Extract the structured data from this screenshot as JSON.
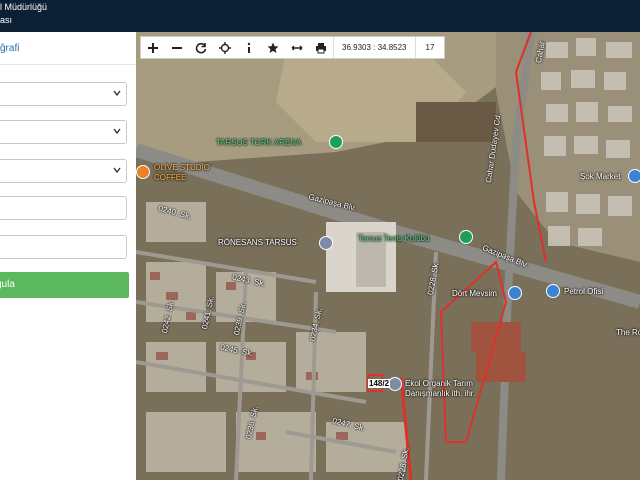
{
  "header": {
    "title_line1": "l Müdürlüğü",
    "title_line2": "ası"
  },
  "panel": {
    "header_label": "ğrafi",
    "submit_label": "gula",
    "fields": [
      {
        "type": "select",
        "value": ""
      },
      {
        "type": "select",
        "value": ""
      },
      {
        "type": "select",
        "value": ""
      },
      {
        "type": "input",
        "value": ""
      },
      {
        "type": "input",
        "value": ""
      }
    ]
  },
  "toolbar": {
    "icons": [
      "plus-icon",
      "minus-icon",
      "refresh-icon",
      "crosshair-icon",
      "info-icon",
      "star-icon",
      "measure-icon",
      "print-icon"
    ],
    "coordinates": "36.9303 : 34.8523",
    "zoom_level": "17"
  },
  "map": {
    "places": {
      "tarsus_tork_arena": "TARSUS TORK ARENA",
      "olive_studio_1": "OLİVE STUDİO",
      "olive_studio_2": "COFFEE",
      "ronesans": "RÖNESANS TARSUS",
      "tenis": "Tarsus Tenis Kulübü",
      "dort_mevsim": "Dört Mevsim",
      "petrol": "Petrol Ofisi",
      "sok": "Şok Market",
      "the_ro": "The Ro",
      "ekol1": "Ekol Organik Tarım",
      "ekol2": "Danışmanlık ith. ihr."
    },
    "roads": {
      "gazipasa1": "Gazipaşa Blv.",
      "gazipasa2": "Gazipaşa Blv.",
      "cahar1": "Cahar Dudayev Cd.",
      "cahar2": "Cahar",
      "s0240": "0240. Sk.",
      "s0243": "0243. Sk.",
      "s0242": "0242. Sk.",
      "s0241": "0241. Sk.",
      "s0239": "0239. Sk.",
      "s0245": "0245. Sk.",
      "s0234": "0234. Sk.",
      "s0228a": "0228. Sk.",
      "s0228b": "0228. Sk.",
      "s0236": "0236. Sk.",
      "s0247": "0247. Sk."
    },
    "parcel_label": "148/2"
  }
}
